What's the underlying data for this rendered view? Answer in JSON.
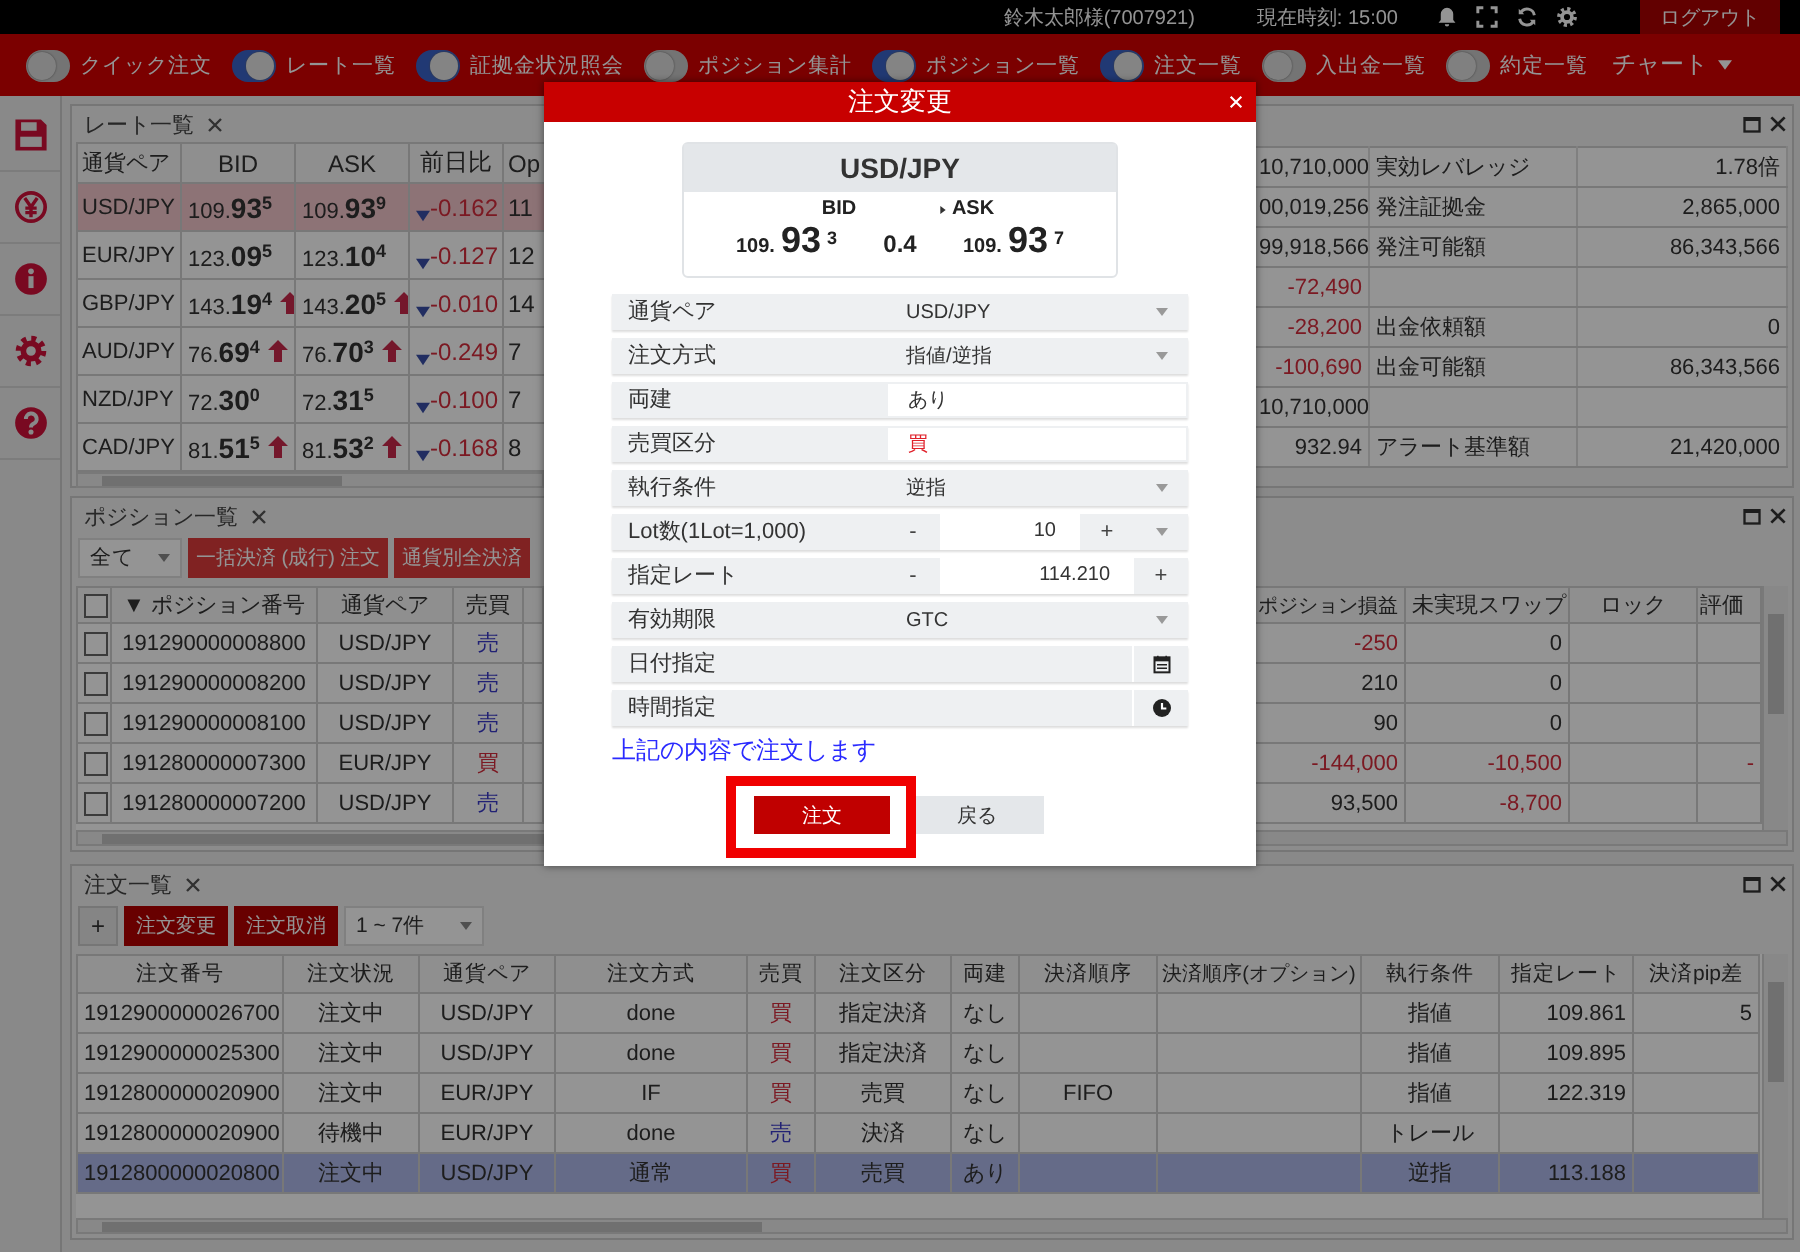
{
  "top_bar": {
    "user": "鈴木太郎様(7007921)",
    "clock": "現在時刻: 15:00",
    "logout": "ログアウト"
  },
  "toolbar": {
    "toggles": [
      {
        "label": "クイック注文",
        "on": false
      },
      {
        "label": "レート一覧",
        "on": true
      },
      {
        "label": "証拠金状況照会",
        "on": true
      },
      {
        "label": "ポジション集計",
        "on": false
      },
      {
        "label": "ポジション一覧",
        "on": true
      },
      {
        "label": "注文一覧",
        "on": true
      },
      {
        "label": "入出金一覧",
        "on": false
      },
      {
        "label": "約定一覧",
        "on": false
      }
    ],
    "chart_menu": "チャート"
  },
  "rate_panel": {
    "tab": "レート一覧",
    "columns": [
      "通貨ペア",
      "BID",
      "ASK",
      "前日比",
      "Op"
    ],
    "rows": [
      {
        "pair": "USD/JPY",
        "bid": "109.**93**$^{5}$",
        "bid_up": false,
        "ask": "109.**93**$^{9}$",
        "ask_up": false,
        "change": "-0.162",
        "change_down": true,
        "column_5": "11",
        "selected": true
      },
      {
        "pair": "EUR/JPY",
        "bid": "123.**09**$^{5}$",
        "bid_up": false,
        "ask": "123.**10**$^{4}$",
        "ask_up": false,
        "change": "-0.127",
        "change_down": true,
        "column_5": "12",
        "selected": false
      },
      {
        "pair": "GBP/JPY",
        "bid": "143.**19**$^{4}$",
        "bid_up": true,
        "ask": "143.**20**$^{5}$",
        "ask_up": true,
        "change": "-0.010",
        "change_down": true,
        "column_5": "14",
        "selected": false
      },
      {
        "pair": "AUD/JPY",
        "bid": "76.**69**$^{4}$",
        "bid_up": true,
        "ask": "76.**70**$^{3}$",
        "ask_up": true,
        "change": "-0.249",
        "change_down": true,
        "column_5": "7",
        "selected": false
      },
      {
        "pair": "NZD/JPY",
        "bid": "72.**30**$^{0}$",
        "bid_up": false,
        "ask": "72.**31**$^{5}$",
        "ask_up": false,
        "change": "-0.100",
        "change_down": true,
        "column_5": "7",
        "selected": false
      },
      {
        "pair": "CAD/JPY",
        "bid": "81.**51**$^{5}$",
        "bid_up": true,
        "ask": "81.**53**$^{2}$",
        "ask_up": true,
        "change": "-0.168",
        "change_down": true,
        "column_5": "8",
        "selected": false
      }
    ]
  },
  "account_panel": {
    "rows": [
      {
        "column_1": "10,710,000",
        "negative": false,
        "label": "実効レバレッジ",
        "value": "1.78倍"
      },
      {
        "column_1": "00,019,256",
        "negative": false,
        "label": "発注証拠金",
        "value": "2,865,000"
      },
      {
        "column_1": "99,918,566",
        "negative": false,
        "label": "発注可能額",
        "value": "86,343,566"
      },
      {
        "column_1": "-72,490",
        "negative": true
      },
      {
        "column_1": "-28,200",
        "negative": true,
        "label": "出金依頼額",
        "value": "0"
      },
      {
        "column_1": "-100,690",
        "negative": true,
        "label": "出金可能額",
        "value": "86,343,566"
      },
      {
        "column_1": "10,710,000",
        "negative": false
      },
      {
        "column_1": "932.94",
        "negative": false,
        "label": "アラート基準額",
        "value": "21,420,000"
      }
    ]
  },
  "position_panel": {
    "tab": "ポジション一覧",
    "filter": "全て",
    "buttons": [
      "一括決済 (成行) 注文",
      "通貨別全決済"
    ],
    "all_checked": false,
    "columns": [
      "▼ ポジション番号",
      "通貨ペア",
      "売買",
      "ポジション損益",
      "未実現スワップ",
      "ロック",
      "評価"
    ],
    "rows": [
      {
        "checked": false,
        "number": "191290000008800",
        "pair": "USD/JPY",
        "side": "売",
        "buy": false,
        "pl": "-250",
        "pl_negative": true,
        "swap": "0",
        "swap_negative": false
      },
      {
        "checked": false,
        "number": "191290000008200",
        "pair": "USD/JPY",
        "side": "売",
        "buy": false,
        "pl": "210",
        "pl_negative": false,
        "swap": "0",
        "swap_negative": false
      },
      {
        "checked": false,
        "number": "191290000008100",
        "pair": "USD/JPY",
        "side": "売",
        "buy": false,
        "pl": "90",
        "pl_negative": false,
        "swap": "0",
        "swap_negative": false
      },
      {
        "checked": false,
        "number": "191280000007300",
        "pair": "EUR/JPY",
        "side": "買",
        "buy": true,
        "pl": "-144,000",
        "pl_negative": true,
        "swap": "-10,500",
        "swap_negative": true,
        "valuation": "-"
      },
      {
        "checked": false,
        "number": "191280000007200",
        "pair": "USD/JPY",
        "side": "売",
        "buy": false,
        "pl": "93,500",
        "pl_negative": false,
        "swap": "-8,700",
        "swap_negative": true
      }
    ]
  },
  "order_panel": {
    "tab": "注文一覧",
    "add": "+",
    "buttons": [
      "注文変更",
      "注文取消"
    ],
    "range": "1 ~ 7件",
    "columns": [
      "注文番号",
      "注文状況",
      "通貨ペア",
      "注文方式",
      "売買",
      "注文区分",
      "両建",
      "決済順序",
      "決済順序(オプション)",
      "執行条件",
      "指定レート",
      "決済pip差"
    ],
    "rows": [
      {
        "number": "1912900000026700",
        "status": "注文中",
        "pair": "USD/JPY",
        "method": "done",
        "side": "買",
        "buy": true,
        "type": "指定決済",
        "hedge": "なし",
        "condition": "指値",
        "rate": "109.861",
        "pip": "5",
        "selected": false
      },
      {
        "number": "1912900000025300",
        "status": "注文中",
        "pair": "USD/JPY",
        "method": "done",
        "side": "買",
        "buy": true,
        "type": "指定決済",
        "hedge": "なし",
        "condition": "指値",
        "rate": "109.895",
        "selected": false
      },
      {
        "number": "1912800000020900",
        "status": "注文中",
        "pair": "EUR/JPY",
        "method": "IF",
        "side": "買",
        "buy": true,
        "type": "売買",
        "hedge": "なし",
        "settlement": "FIFO",
        "condition": "指値",
        "rate": "122.319",
        "selected": false
      },
      {
        "number": "1912800000020900",
        "status": "待機中",
        "pair": "EUR/JPY",
        "method": "done",
        "side": "売",
        "buy": false,
        "type": "決済",
        "hedge": "なし",
        "condition": "トレール",
        "selected": false
      },
      {
        "number": "1912800000020800",
        "status": "注文中",
        "pair": "USD/JPY",
        "method": "通常",
        "side": "買",
        "buy": true,
        "type": "売買",
        "hedge": "あり",
        "condition": "逆指",
        "rate": "113.188",
        "selected": true
      }
    ]
  },
  "modal": {
    "title": "注文変更",
    "quote": {
      "pair": "USD/JPY",
      "bid_label": "BID",
      "ask_label": "ASK",
      "bid": "109.**93**$^{3}$",
      "spread": "0.4",
      "ask": "109.**93**$^{7}$"
    },
    "fields": [
      {
        "label": "通貨ペア",
        "kind": "select",
        "value": "USD/JPY"
      },
      {
        "label": "注文方式",
        "kind": "select",
        "value": "指値/逆指"
      },
      {
        "label": "両建",
        "kind": "text",
        "value": "あり"
      },
      {
        "label": "売買区分",
        "kind": "side",
        "value": "買",
        "buy": true
      },
      {
        "label": "執行条件",
        "kind": "select",
        "value": "逆指"
      },
      {
        "label": "Lot数(1Lot=1,000)",
        "kind": "stepper_select",
        "minus": "-",
        "value": "10",
        "plus": "+"
      },
      {
        "label": "指定レート",
        "kind": "stepper",
        "minus": "-",
        "value": "114.210",
        "plus": "+"
      },
      {
        "label": "有効期限",
        "kind": "select",
        "value": "GTC"
      },
      {
        "label": "日付指定",
        "kind": "date"
      },
      {
        "label": "時間指定",
        "kind": "time"
      }
    ],
    "note": "上記の内容で注文します",
    "submit": "注文",
    "submit_highlighted": true,
    "back": "戻る"
  }
}
